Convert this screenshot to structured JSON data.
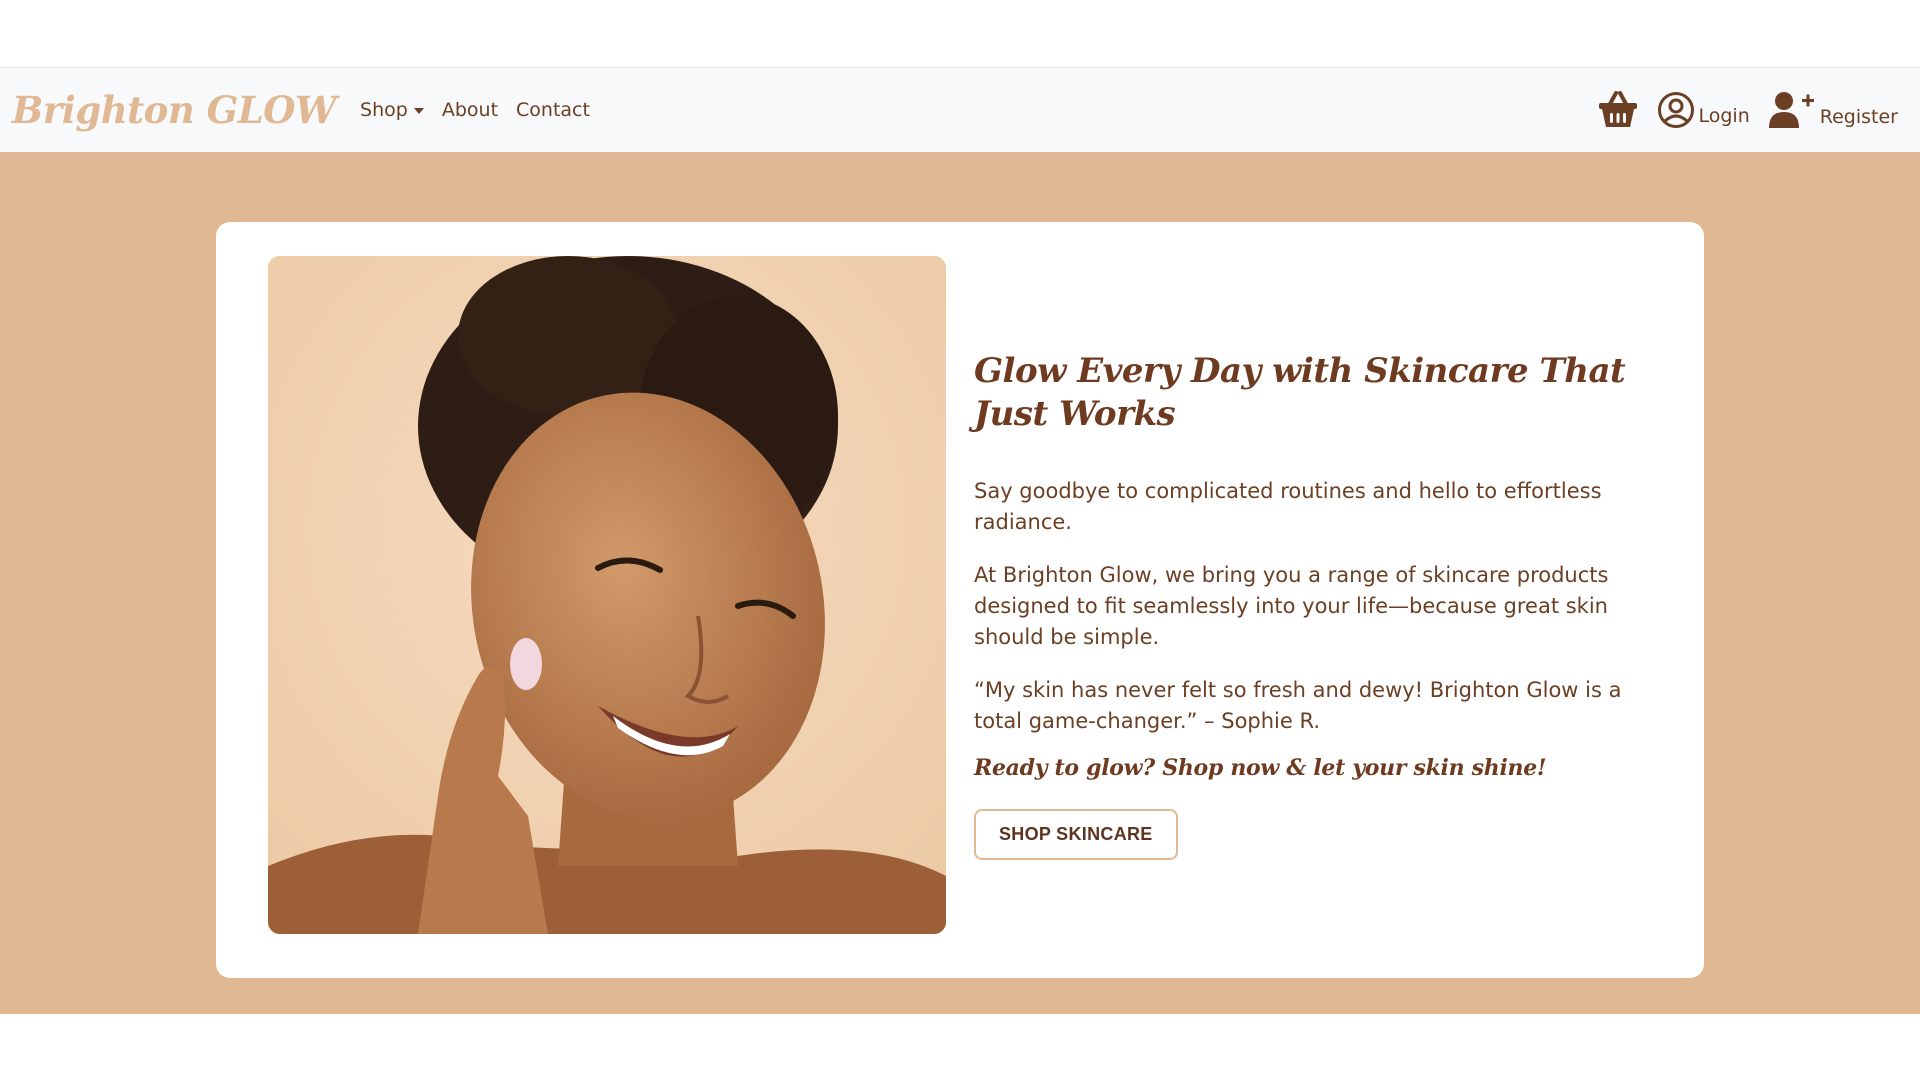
{
  "brand": {
    "name": "Brighton GLOW"
  },
  "nav": {
    "items": [
      {
        "label": "Shop",
        "has_dropdown": true
      },
      {
        "label": "About"
      },
      {
        "label": "Contact"
      }
    ]
  },
  "account": {
    "cart_icon": "basket-icon",
    "login_label": "Login",
    "login_icon": "user-circle-icon",
    "register_label": "Register",
    "register_icon": "user-plus-icon"
  },
  "hero": {
    "headline": "Glow Every Day with Skincare That Just Works",
    "paragraphs": [
      "Say goodbye to complicated routines and hello to effortless radiance.",
      "At Brighton Glow, we bring you a range of skincare products designed to fit seamlessly into your life—because great skin should be simple.",
      "“My skin has never felt so fresh and dewy! Brighton Glow is a total game-changer.” – Sophie R."
    ],
    "tagline": "Ready to glow? Shop now & let your skin shine!",
    "button_label": "SHOP SKINCARE"
  },
  "colors": {
    "accent": "#e0b894",
    "text_brown": "#6b3f24",
    "heading_brown": "#6e3a20",
    "navbar_bg": "#f8f9fb"
  }
}
